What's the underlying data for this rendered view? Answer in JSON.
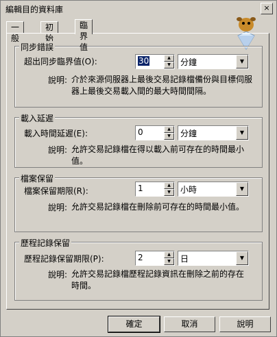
{
  "window": {
    "title": "編輯目的資料庫",
    "close_label": "×"
  },
  "tabs": [
    {
      "label": "一般",
      "active": false
    },
    {
      "label": "初始化",
      "active": false
    },
    {
      "label": "臨界值",
      "active": true
    }
  ],
  "groups": {
    "sync_error": {
      "title": "同步錯誤",
      "field_label": "超出同步臨界值(O):",
      "value": "30",
      "unit": "分鐘",
      "desc_label": "說明:",
      "description": "介於來源伺服器上最後交易記錄檔備份與目標伺服器上最後交易載入間的最大時間間隔。"
    },
    "load_delay": {
      "title": "載入延遲",
      "field_label": "載入時間延遲(E):",
      "value": "0",
      "unit": "分鐘",
      "desc_label": "說明:",
      "description": "允許交易記錄檔在得以載入前可存在的時間最小值。"
    },
    "file_retention": {
      "title": "檔案保留",
      "field_label": "檔案保留期限(R):",
      "value": "1",
      "unit": "小時",
      "desc_label": "說明:",
      "description": "允許交易記錄檔在刪除前可存在的時間最小值。"
    },
    "history_retention": {
      "title": "歷程記錄保留",
      "field_label": "歷程記錄保留期限(P):",
      "value": "2",
      "unit": "日",
      "desc_label": "說明:",
      "description": "允許交易記錄檔歷程記錄資訊在刪除之前的存在時間。"
    }
  },
  "buttons": {
    "ok": "確定",
    "cancel": "取消",
    "help": "說明"
  }
}
